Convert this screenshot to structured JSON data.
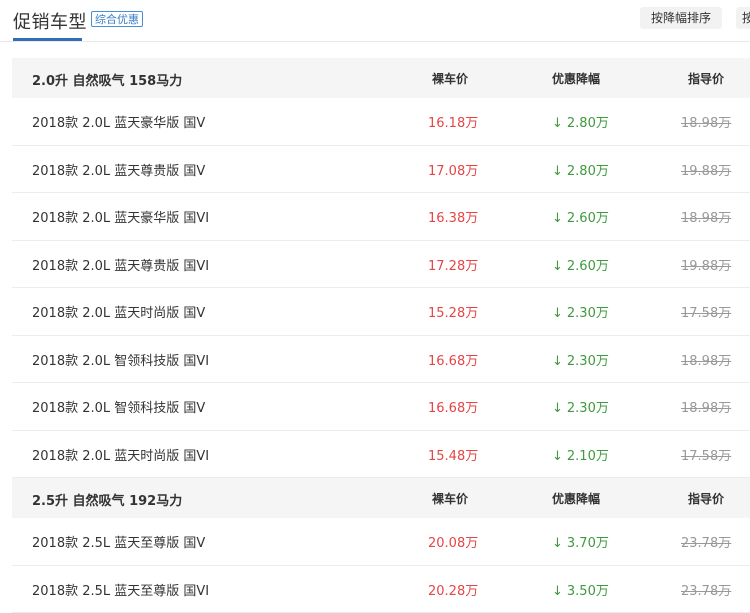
{
  "header": {
    "title": "促销车型",
    "tag": "综合优惠",
    "sort_button": "按降幅排序",
    "sort_button2": "按"
  },
  "colors": {
    "accent": "#2f6fb2",
    "price": "#e64545",
    "discount": "#3e9a3e",
    "guide": "#999999"
  },
  "groups": [
    {
      "title": "2.0升 自然吸气 158马力",
      "columns": {
        "price": "裸车价",
        "discount": "优惠降幅",
        "guide": "指导价"
      },
      "rows": [
        {
          "name": "2018款 2.0L 蓝天豪华版 国V",
          "price": "16.18万",
          "discount": "2.80万",
          "guide": "18.98万"
        },
        {
          "name": "2018款 2.0L 蓝天尊贵版 国V",
          "price": "17.08万",
          "discount": "2.80万",
          "guide": "19.88万"
        },
        {
          "name": "2018款 2.0L 蓝天豪华版 国VI",
          "price": "16.38万",
          "discount": "2.60万",
          "guide": "18.98万"
        },
        {
          "name": "2018款 2.0L 蓝天尊贵版 国VI",
          "price": "17.28万",
          "discount": "2.60万",
          "guide": "19.88万"
        },
        {
          "name": "2018款 2.0L 蓝天时尚版 国V",
          "price": "15.28万",
          "discount": "2.30万",
          "guide": "17.58万"
        },
        {
          "name": "2018款 2.0L 智领科技版 国VI",
          "price": "16.68万",
          "discount": "2.30万",
          "guide": "18.98万"
        },
        {
          "name": "2018款 2.0L 智领科技版 国V",
          "price": "16.68万",
          "discount": "2.30万",
          "guide": "18.98万"
        },
        {
          "name": "2018款 2.0L 蓝天时尚版 国VI",
          "price": "15.48万",
          "discount": "2.10万",
          "guide": "17.58万"
        }
      ]
    },
    {
      "title": "2.5升 自然吸气 192马力",
      "columns": {
        "price": "裸车价",
        "discount": "优惠降幅",
        "guide": "指导价"
      },
      "rows": [
        {
          "name": "2018款 2.5L 蓝天至尊版 国V",
          "price": "20.08万",
          "discount": "3.70万",
          "guide": "23.78万"
        },
        {
          "name": "2018款 2.5L 蓝天至尊版 国VI",
          "price": "20.28万",
          "discount": "3.50万",
          "guide": "23.78万"
        }
      ]
    }
  ]
}
